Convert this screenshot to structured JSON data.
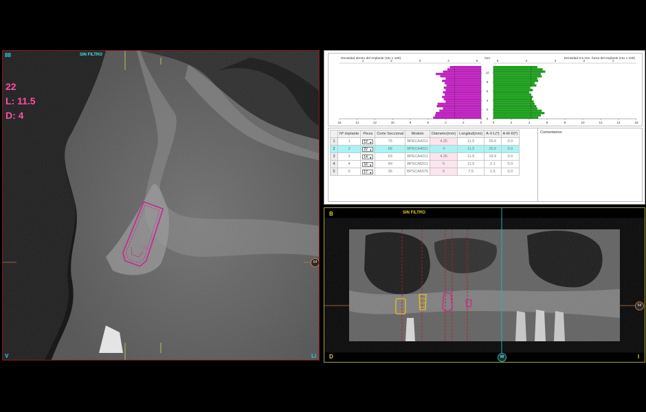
{
  "left_view": {
    "corner_tl": "88",
    "filter_label": "SIN FILTRO",
    "implant_number": "22",
    "length_text": "L: 11.5",
    "diameter_text": "D: 4",
    "corner_bl": "V",
    "corner_br": "Li",
    "slice_marker": "64",
    "implant_tag": "22"
  },
  "right_view": {
    "corner_tl": "B",
    "filter_label": "SIN FILTRO",
    "corner_bl": "D",
    "corner_br": "I",
    "marker_bottom": "88",
    "marker_right": "64"
  },
  "chart_data": {
    "type": "bar",
    "left_title": "Densidad dentro del Implante (HU x 100)",
    "right_title": "Densidad 0.5 mm. fuera del Implante (HU x 100)",
    "unit_label": "mm",
    "y_ticks": [
      "10",
      "8",
      "6",
      "4",
      "2",
      "0"
    ],
    "left_x_ticks_bottom": [
      "16",
      "14",
      "12",
      "10",
      "8",
      "6",
      "4",
      "2",
      "0"
    ],
    "right_x_ticks_bottom": [
      "0",
      "2",
      "4",
      "6",
      "8",
      "10",
      "12",
      "14",
      "16"
    ],
    "left_x_ticks_top": [
      "1",
      "2",
      "3",
      "4",
      "5"
    ],
    "right_x_ticks_top": [
      "5",
      "4",
      "3",
      "2",
      "1"
    ],
    "xlim": [
      0,
      16
    ],
    "ylim": [
      0,
      11.5
    ],
    "left_color": "#c31cc3",
    "right_color": "#17a317",
    "left_series": [
      {
        "y": 0.25,
        "v": 5.4
      },
      {
        "y": 0.75,
        "v": 5.2
      },
      {
        "y": 1.25,
        "v": 5.1
      },
      {
        "y": 1.75,
        "v": 4.7
      },
      {
        "y": 2.25,
        "v": 4.3
      },
      {
        "y": 2.75,
        "v": 5.0
      },
      {
        "y": 3.25,
        "v": 4.9
      },
      {
        "y": 3.75,
        "v": 4.0
      },
      {
        "y": 4.25,
        "v": 4.2
      },
      {
        "y": 4.75,
        "v": 4.4
      },
      {
        "y": 5.25,
        "v": 4.1
      },
      {
        "y": 5.75,
        "v": 4.3
      },
      {
        "y": 6.25,
        "v": 4.0
      },
      {
        "y": 6.75,
        "v": 4.2
      },
      {
        "y": 7.25,
        "v": 3.9
      },
      {
        "y": 7.75,
        "v": 4.1
      },
      {
        "y": 8.25,
        "v": 4.4
      },
      {
        "y": 8.75,
        "v": 4.0
      },
      {
        "y": 9.25,
        "v": 4.6
      },
      {
        "y": 9.75,
        "v": 5.1
      },
      {
        "y": 10.25,
        "v": 4.3
      },
      {
        "y": 10.75,
        "v": 3.8
      },
      {
        "y": 11.25,
        "v": 3.5
      }
    ],
    "right_series": [
      {
        "y": 0.25,
        "v": 5.0
      },
      {
        "y": 0.75,
        "v": 5.3
      },
      {
        "y": 1.25,
        "v": 5.7
      },
      {
        "y": 1.75,
        "v": 5.4
      },
      {
        "y": 2.25,
        "v": 4.9
      },
      {
        "y": 2.75,
        "v": 4.8
      },
      {
        "y": 3.25,
        "v": 4.6
      },
      {
        "y": 3.75,
        "v": 4.5
      },
      {
        "y": 4.25,
        "v": 4.3
      },
      {
        "y": 4.75,
        "v": 4.4
      },
      {
        "y": 5.25,
        "v": 4.2
      },
      {
        "y": 5.75,
        "v": 4.0
      },
      {
        "y": 6.25,
        "v": 4.4
      },
      {
        "y": 6.75,
        "v": 4.1
      },
      {
        "y": 7.25,
        "v": 4.8
      },
      {
        "y": 7.75,
        "v": 4.6
      },
      {
        "y": 8.25,
        "v": 5.0
      },
      {
        "y": 8.75,
        "v": 4.9
      },
      {
        "y": 9.25,
        "v": 5.4
      },
      {
        "y": 9.75,
        "v": 5.3
      },
      {
        "y": 10.25,
        "v": 5.8
      },
      {
        "y": 10.75,
        "v": 5.5
      },
      {
        "y": 11.25,
        "v": 4.9
      }
    ],
    "left_dashed_at": 3.0,
    "right_dashed_at": 4.2
  },
  "implant_table": {
    "headers": [
      "Nº implante",
      "Pieza",
      "Corte Seccional",
      "Modelo",
      "Diámetro(mm)",
      "Longitud(mm)",
      "A-V-L(º)",
      "A-M-D(º)"
    ],
    "rows": [
      {
        "row": "1",
        "num": "1",
        "pieza": "12",
        "corte": "75",
        "modelo": "BPECA4211",
        "diam": "4.25",
        "long": "11.5",
        "avl": "25.6",
        "amd": "0.0"
      },
      {
        "row": "2",
        "num": "2",
        "pieza": "22",
        "corte": "88",
        "modelo": "BPECA4011",
        "diam": "4",
        "long": "11.5",
        "avl": "20.5",
        "amd": "0.0"
      },
      {
        "row": "3",
        "num": "3",
        "pieza": "14",
        "corte": "63",
        "modelo": "BPECA4211",
        "diam": "4.25",
        "long": "11.5",
        "avl": "19.9",
        "amd": "0.0"
      },
      {
        "row": "4",
        "num": "4",
        "pieza": "16",
        "corte": "49",
        "modelo": "BPSCA5011",
        "diam": "5",
        "long": "11.5",
        "avl": "2.1",
        "amd": "0.0"
      },
      {
        "row": "5",
        "num": "5",
        "pieza": "17",
        "corte": "36",
        "modelo": "BPSCA6075",
        "diam": "6",
        "long": "7.5",
        "avl": "1.5",
        "amd": "0.0"
      }
    ],
    "selected_row": 1,
    "comments_label": "Comentarios:"
  }
}
